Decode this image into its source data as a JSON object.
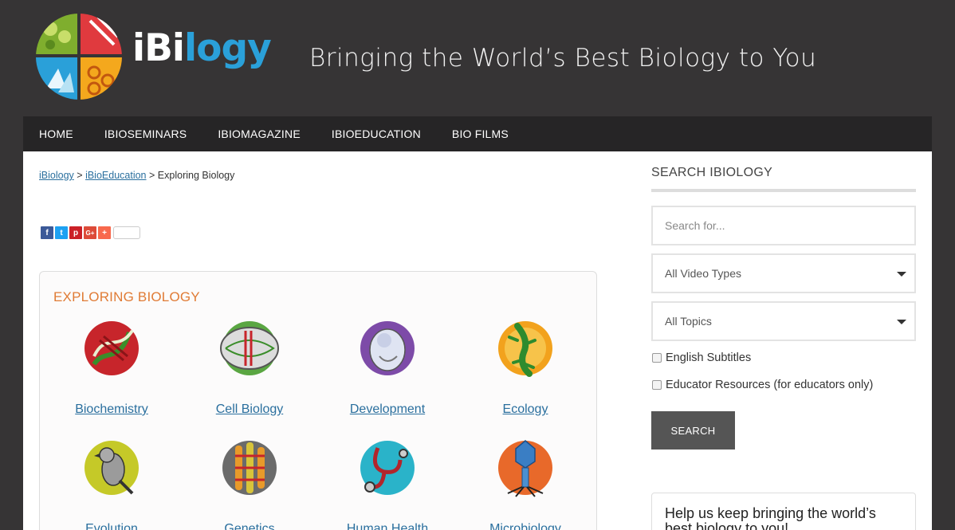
{
  "header": {
    "logo_text_white": "iBi",
    "logo_text_blue": "logy",
    "tagline": "Bringing the World’s Best Biology to You"
  },
  "nav": {
    "items": [
      "HOME",
      "IBIOSEMINARS",
      "IBIOMAGAZINE",
      "IBIOEDUCATION",
      "BIO FILMS"
    ]
  },
  "breadcrumb": {
    "home": "iBiology",
    "sep1": ">",
    "section": "iBioEducation",
    "sep2": ">",
    "current": "Exploring Biology"
  },
  "share": {
    "facebook": "f",
    "twitter": "t",
    "pinterest": "p",
    "gplus": "G+",
    "more": "+"
  },
  "exploring": {
    "title": "EXPLORING BIOLOGY",
    "topics": [
      {
        "label": "Biochemistry",
        "icon": "dna-icon"
      },
      {
        "label": "Cell Biology",
        "icon": "cell-icon"
      },
      {
        "label": "Development",
        "icon": "embryo-icon"
      },
      {
        "label": "Ecology",
        "icon": "lizard-icon"
      },
      {
        "label": "Evolution",
        "icon": "bird-icon"
      },
      {
        "label": "Genetics",
        "icon": "chromosome-icon"
      },
      {
        "label": "Human Health",
        "icon": "stethoscope-icon"
      },
      {
        "label": "Microbiology",
        "icon": "virus-icon"
      }
    ]
  },
  "sidebar": {
    "title": "SEARCH IBIOLOGY",
    "search_placeholder": "Search for...",
    "video_types": "All Video Types",
    "topics": "All Topics",
    "subtitles_label": "English Subtitles",
    "educator_label": "Educator Resources (for educators only)",
    "search_button": "SEARCH",
    "promo_text": "Help us keep bringing the world’s best biology to you!"
  },
  "colors": {
    "header_bg": "#363435",
    "nav_bg": "#262526",
    "accent_orange": "#e07b35",
    "logo_blue": "#2aa0d9",
    "link_blue": "#2a6f9e"
  }
}
